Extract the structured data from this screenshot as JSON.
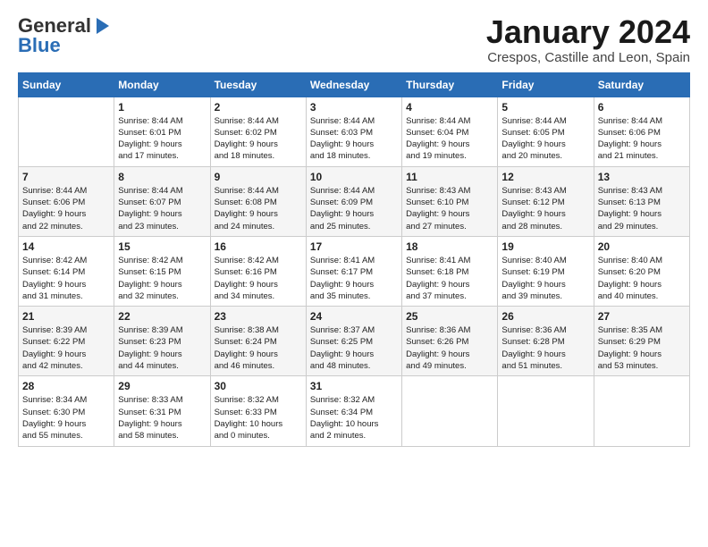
{
  "logo": {
    "general": "General",
    "blue": "Blue",
    "icon": "▶"
  },
  "title": "January 2024",
  "subtitle": "Crespos, Castille and Leon, Spain",
  "headers": [
    "Sunday",
    "Monday",
    "Tuesday",
    "Wednesday",
    "Thursday",
    "Friday",
    "Saturday"
  ],
  "weeks": [
    [
      {
        "day": "",
        "info": ""
      },
      {
        "day": "1",
        "info": "Sunrise: 8:44 AM\nSunset: 6:01 PM\nDaylight: 9 hours\nand 17 minutes."
      },
      {
        "day": "2",
        "info": "Sunrise: 8:44 AM\nSunset: 6:02 PM\nDaylight: 9 hours\nand 18 minutes."
      },
      {
        "day": "3",
        "info": "Sunrise: 8:44 AM\nSunset: 6:03 PM\nDaylight: 9 hours\nand 18 minutes."
      },
      {
        "day": "4",
        "info": "Sunrise: 8:44 AM\nSunset: 6:04 PM\nDaylight: 9 hours\nand 19 minutes."
      },
      {
        "day": "5",
        "info": "Sunrise: 8:44 AM\nSunset: 6:05 PM\nDaylight: 9 hours\nand 20 minutes."
      },
      {
        "day": "6",
        "info": "Sunrise: 8:44 AM\nSunset: 6:06 PM\nDaylight: 9 hours\nand 21 minutes."
      }
    ],
    [
      {
        "day": "7",
        "info": "Sunrise: 8:44 AM\nSunset: 6:06 PM\nDaylight: 9 hours\nand 22 minutes."
      },
      {
        "day": "8",
        "info": "Sunrise: 8:44 AM\nSunset: 6:07 PM\nDaylight: 9 hours\nand 23 minutes."
      },
      {
        "day": "9",
        "info": "Sunrise: 8:44 AM\nSunset: 6:08 PM\nDaylight: 9 hours\nand 24 minutes."
      },
      {
        "day": "10",
        "info": "Sunrise: 8:44 AM\nSunset: 6:09 PM\nDaylight: 9 hours\nand 25 minutes."
      },
      {
        "day": "11",
        "info": "Sunrise: 8:43 AM\nSunset: 6:10 PM\nDaylight: 9 hours\nand 27 minutes."
      },
      {
        "day": "12",
        "info": "Sunrise: 8:43 AM\nSunset: 6:12 PM\nDaylight: 9 hours\nand 28 minutes."
      },
      {
        "day": "13",
        "info": "Sunrise: 8:43 AM\nSunset: 6:13 PM\nDaylight: 9 hours\nand 29 minutes."
      }
    ],
    [
      {
        "day": "14",
        "info": "Sunrise: 8:42 AM\nSunset: 6:14 PM\nDaylight: 9 hours\nand 31 minutes."
      },
      {
        "day": "15",
        "info": "Sunrise: 8:42 AM\nSunset: 6:15 PM\nDaylight: 9 hours\nand 32 minutes."
      },
      {
        "day": "16",
        "info": "Sunrise: 8:42 AM\nSunset: 6:16 PM\nDaylight: 9 hours\nand 34 minutes."
      },
      {
        "day": "17",
        "info": "Sunrise: 8:41 AM\nSunset: 6:17 PM\nDaylight: 9 hours\nand 35 minutes."
      },
      {
        "day": "18",
        "info": "Sunrise: 8:41 AM\nSunset: 6:18 PM\nDaylight: 9 hours\nand 37 minutes."
      },
      {
        "day": "19",
        "info": "Sunrise: 8:40 AM\nSunset: 6:19 PM\nDaylight: 9 hours\nand 39 minutes."
      },
      {
        "day": "20",
        "info": "Sunrise: 8:40 AM\nSunset: 6:20 PM\nDaylight: 9 hours\nand 40 minutes."
      }
    ],
    [
      {
        "day": "21",
        "info": "Sunrise: 8:39 AM\nSunset: 6:22 PM\nDaylight: 9 hours\nand 42 minutes."
      },
      {
        "day": "22",
        "info": "Sunrise: 8:39 AM\nSunset: 6:23 PM\nDaylight: 9 hours\nand 44 minutes."
      },
      {
        "day": "23",
        "info": "Sunrise: 8:38 AM\nSunset: 6:24 PM\nDaylight: 9 hours\nand 46 minutes."
      },
      {
        "day": "24",
        "info": "Sunrise: 8:37 AM\nSunset: 6:25 PM\nDaylight: 9 hours\nand 48 minutes."
      },
      {
        "day": "25",
        "info": "Sunrise: 8:36 AM\nSunset: 6:26 PM\nDaylight: 9 hours\nand 49 minutes."
      },
      {
        "day": "26",
        "info": "Sunrise: 8:36 AM\nSunset: 6:28 PM\nDaylight: 9 hours\nand 51 minutes."
      },
      {
        "day": "27",
        "info": "Sunrise: 8:35 AM\nSunset: 6:29 PM\nDaylight: 9 hours\nand 53 minutes."
      }
    ],
    [
      {
        "day": "28",
        "info": "Sunrise: 8:34 AM\nSunset: 6:30 PM\nDaylight: 9 hours\nand 55 minutes."
      },
      {
        "day": "29",
        "info": "Sunrise: 8:33 AM\nSunset: 6:31 PM\nDaylight: 9 hours\nand 58 minutes."
      },
      {
        "day": "30",
        "info": "Sunrise: 8:32 AM\nSunset: 6:33 PM\nDaylight: 10 hours\nand 0 minutes."
      },
      {
        "day": "31",
        "info": "Sunrise: 8:32 AM\nSunset: 6:34 PM\nDaylight: 10 hours\nand 2 minutes."
      },
      {
        "day": "",
        "info": ""
      },
      {
        "day": "",
        "info": ""
      },
      {
        "day": "",
        "info": ""
      }
    ]
  ]
}
